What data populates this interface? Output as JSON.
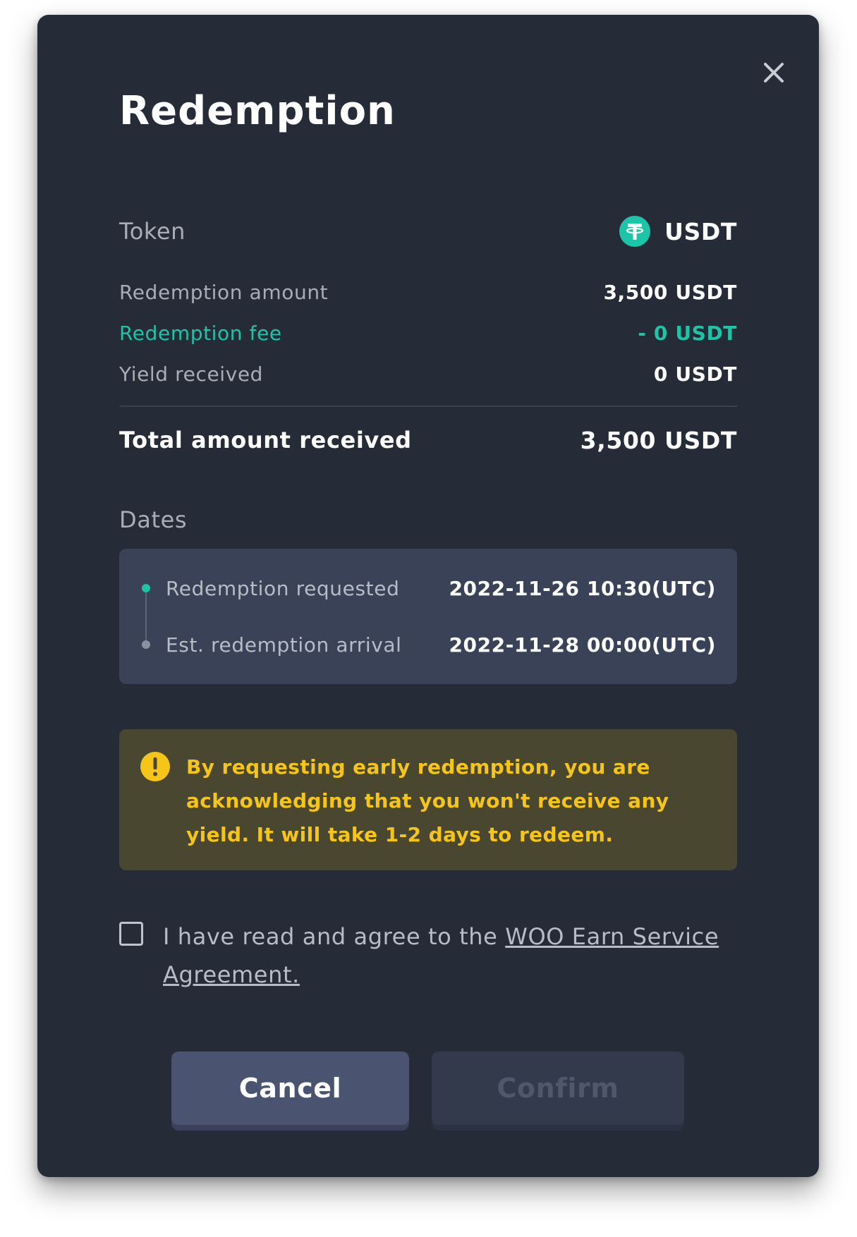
{
  "modal": {
    "title": "Redemption"
  },
  "token": {
    "label": "Token",
    "name": "USDT",
    "icon": "tether-icon",
    "icon_color": "#1ec4a7"
  },
  "details": {
    "redemption_amount_label": "Redemption amount",
    "redemption_amount_value": "3,500 USDT",
    "redemption_fee_label": "Redemption fee",
    "redemption_fee_value": "- 0 USDT",
    "yield_received_label": "Yield received",
    "yield_received_value": "0 USDT",
    "total_label": "Total amount received",
    "total_value": "3,500 USDT"
  },
  "dates": {
    "heading": "Dates",
    "items": [
      {
        "label": "Redemption requested",
        "value": "2022-11-26 10:30(UTC)"
      },
      {
        "label": "Est. redemption arrival",
        "value": "2022-11-28 00:00(UTC)"
      }
    ]
  },
  "warning": {
    "icon": "exclamation-icon",
    "text": "By requesting early redemption, you are acknowledging that you won't receive any yield. It will take 1-2 days to redeem."
  },
  "agreement": {
    "checked": false,
    "prefix": "I have read and agree to the ",
    "link_text": "WOO Earn Service Agreement."
  },
  "buttons": {
    "cancel": "Cancel",
    "confirm": "Confirm",
    "confirm_disabled": true
  },
  "colors": {
    "background": "#252b37",
    "accent": "#1ec4a7",
    "warning": "#f5c518",
    "warning_bg": "#4a4731"
  }
}
